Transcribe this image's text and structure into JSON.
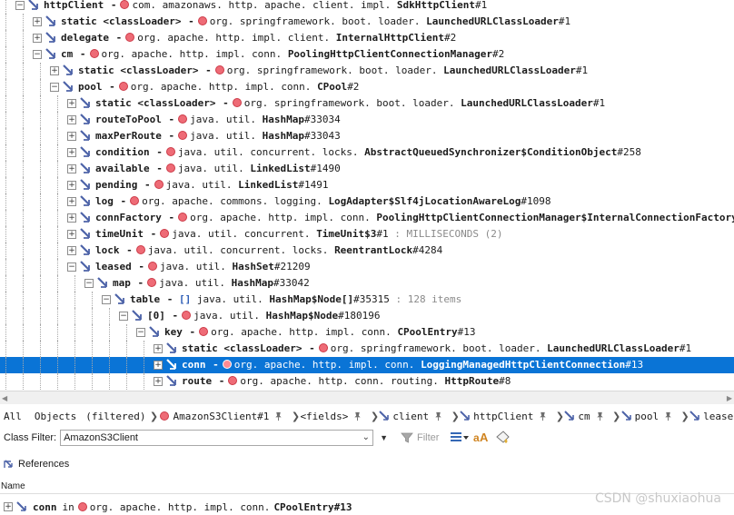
{
  "tree": {
    "rows": [
      {
        "depth": 3,
        "expanded": true,
        "name": "httpClient",
        "sep": "-",
        "pkg": "com. amazonaws. http. apache. client. impl.",
        "cls": "SdkHttpClient",
        "id": "#1"
      },
      {
        "depth": 4,
        "expanded": false,
        "name": "static <classLoader>",
        "sep": "-",
        "pkg": "org. springframework. boot. loader.",
        "cls": "LaunchedURLClassLoader",
        "id": "#1"
      },
      {
        "depth": 4,
        "expanded": false,
        "name": "delegate",
        "sep": "-",
        "pkg": "org. apache. http. impl. client.",
        "cls": "InternalHttpClient",
        "id": "#2"
      },
      {
        "depth": 4,
        "expanded": true,
        "name": "cm",
        "sep": "-",
        "pkg": "org. apache. http. impl. conn.",
        "cls": "PoolingHttpClientConnectionManager",
        "id": "#2"
      },
      {
        "depth": 5,
        "expanded": false,
        "name": "static <classLoader>",
        "sep": "-",
        "pkg": "org. springframework. boot. loader.",
        "cls": "LaunchedURLClassLoader",
        "id": "#1"
      },
      {
        "depth": 5,
        "expanded": true,
        "name": "pool",
        "sep": "-",
        "pkg": "org. apache. http. impl. conn.",
        "cls": "CPool",
        "id": "#2"
      },
      {
        "depth": 6,
        "expanded": false,
        "name": "static <classLoader>",
        "sep": "-",
        "pkg": "org. springframework. boot. loader.",
        "cls": "LaunchedURLClassLoader",
        "id": "#1"
      },
      {
        "depth": 6,
        "expanded": false,
        "name": "routeToPool",
        "sep": "-",
        "pkg": "java. util.",
        "cls": "HashMap",
        "id": "#33034"
      },
      {
        "depth": 6,
        "expanded": false,
        "name": "maxPerRoute",
        "sep": "-",
        "pkg": "java. util.",
        "cls": "HashMap",
        "id": "#33043"
      },
      {
        "depth": 6,
        "expanded": false,
        "name": "condition",
        "sep": "-",
        "pkg": "java. util. concurrent. locks.",
        "cls": "AbstractQueuedSynchronizer$ConditionObject",
        "id": "#258"
      },
      {
        "depth": 6,
        "expanded": false,
        "name": "available",
        "sep": "-",
        "pkg": "java. util.",
        "cls": "LinkedList",
        "id": "#1490"
      },
      {
        "depth": 6,
        "expanded": false,
        "name": "pending",
        "sep": "-",
        "pkg": "java. util.",
        "cls": "LinkedList",
        "id": "#1491"
      },
      {
        "depth": 6,
        "expanded": false,
        "name": "log",
        "sep": "-",
        "pkg": "org. apache. commons. logging.",
        "cls": "LogAdapter$Slf4jLocationAwareLog",
        "id": "#1098"
      },
      {
        "depth": 6,
        "expanded": false,
        "name": "connFactory",
        "sep": "-",
        "pkg": "org. apache. http. impl. conn.",
        "cls": "PoolingHttpClientConnectionManager$InternalConnectionFactory",
        "id": "#2"
      },
      {
        "depth": 6,
        "expanded": false,
        "name": "timeUnit",
        "sep": "-",
        "pkg": "java. util. concurrent.",
        "cls": "TimeUnit$3",
        "id": "#1",
        "extra": ": MILLISECONDS (2)"
      },
      {
        "depth": 6,
        "expanded": false,
        "name": "lock",
        "sep": "-",
        "pkg": "java. util. concurrent. locks.",
        "cls": "ReentrantLock",
        "id": "#4284"
      },
      {
        "depth": 6,
        "expanded": true,
        "name": "leased",
        "sep": "-",
        "pkg": "java. util.",
        "cls": "HashSet",
        "id": "#21209"
      },
      {
        "depth": 7,
        "expanded": true,
        "name": "map",
        "sep": "-",
        "pkg": "java. util.",
        "cls": "HashMap",
        "id": "#33042"
      },
      {
        "depth": 8,
        "expanded": true,
        "name": "table",
        "sep": "-",
        "array": true,
        "pkg": "java. util.",
        "cls": "HashMap$Node[]",
        "id": "#35315",
        "extra": ": 128 items"
      },
      {
        "depth": 9,
        "expanded": true,
        "name": "[0]",
        "sep": "-",
        "pkg": "java. util.",
        "cls": "HashMap$Node",
        "id": "#180196"
      },
      {
        "depth": 10,
        "expanded": true,
        "name": "key",
        "sep": "-",
        "pkg": "org. apache. http. impl. conn.",
        "cls": "CPoolEntry",
        "id": "#13"
      },
      {
        "depth": 11,
        "expanded": false,
        "name": "static <classLoader>",
        "sep": "-",
        "pkg": "org. springframework. boot. loader.",
        "cls": "LaunchedURLClassLoader",
        "id": "#1"
      },
      {
        "depth": 11,
        "expanded": false,
        "name": "conn",
        "sep": "-",
        "pkg": "org. apache. http. impl. conn.",
        "cls": "LoggingManagedHttpClientConnection",
        "id": "#13",
        "selected": true
      },
      {
        "depth": 11,
        "expanded": false,
        "name": "route",
        "sep": "-",
        "pkg": "org. apache. http. conn. routing.",
        "cls": "HttpRoute",
        "id": "#8"
      }
    ]
  },
  "breadcrumb": {
    "all": "All",
    "objects": "Objects",
    "filtered": "(filtered)",
    "items": [
      {
        "label": "AmazonS3Client#1",
        "icon": "instance-dot-icon"
      },
      {
        "label": "<fields>",
        "icon": "none"
      },
      {
        "label": "client",
        "icon": "field-arrow-icon"
      },
      {
        "label": "httpClient",
        "icon": "field-arrow-icon"
      },
      {
        "label": "cm",
        "icon": "field-arrow-icon"
      },
      {
        "label": "pool",
        "icon": "field-arrow-icon"
      },
      {
        "label": "lease",
        "icon": "field-arrow-icon"
      }
    ]
  },
  "filter": {
    "label": "Class Filter:",
    "value": "AmazonS3Client",
    "button": "Filter"
  },
  "references": {
    "title": "References",
    "column": "Name",
    "row": {
      "name": "conn",
      "in": "in",
      "pkg": "org. apache. http. impl. conn.",
      "cls": "CPoolEntry",
      "id": "#13"
    }
  },
  "watermark": "CSDN @shuxiaohua",
  "colors": {
    "selection": "#0a74d6",
    "instance_dot": "#ee6b76",
    "field_arrow": "#4d63a8"
  }
}
